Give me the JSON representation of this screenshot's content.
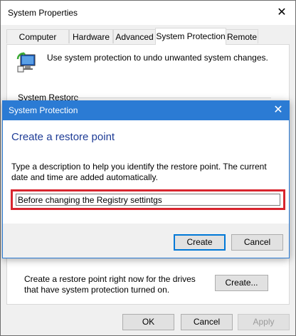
{
  "outer": {
    "title": "System Properties",
    "tabs": [
      {
        "label": "Computer Name"
      },
      {
        "label": "Hardware"
      },
      {
        "label": "Advanced"
      },
      {
        "label": "System Protection"
      },
      {
        "label": "Remote"
      }
    ],
    "intro_text": "Use system protection to undo unwanted system changes.",
    "system_restore_label": "System Restore",
    "create_text": "Create a restore point right now for the drives that have system protection turned on.",
    "create_button": "Create...",
    "ok_button": "OK",
    "cancel_button": "Cancel",
    "apply_button": "Apply"
  },
  "dialog": {
    "title": "System Protection",
    "heading": "Create a restore point",
    "description": "Type a description to help you identify the restore point. The current date and time are added automatically.",
    "input_value": "Before changing the Registry settintgs",
    "create_button": "Create",
    "cancel_button": "Cancel",
    "accent_color": "#2b7bd4",
    "highlight_color": "#d8252e"
  },
  "icons": {
    "outer_close": "close-icon",
    "dialog_close": "close-icon",
    "system_icon": "system-protection-icon"
  }
}
